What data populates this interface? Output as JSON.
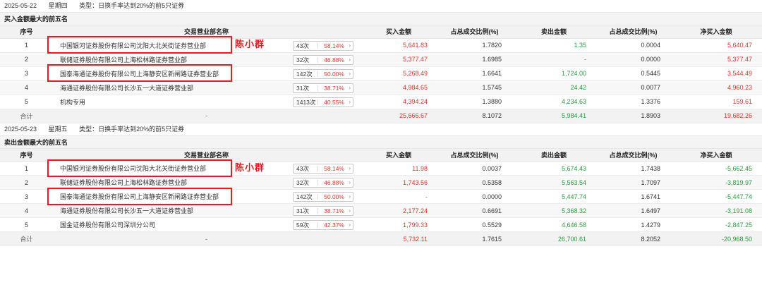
{
  "blocks": [
    {
      "date": "2025-05-22",
      "weekday": "星期四",
      "type_text": "类型：日换手率达到20%的前5只证券",
      "section_title": "买入金额最大的前五名",
      "rows": [
        {
          "idx": "1",
          "name": "中国银河证券股份有限公司沈阳大北关街证券营业部",
          "count": "43次",
          "pct": "58.14%",
          "buy": "5,641.83",
          "buy_ratio": "1.7820",
          "sell": "1.35",
          "sell_ratio": "0.0004",
          "net": "5,640.47"
        },
        {
          "idx": "2",
          "name": "联储证券股份有限公司上海松林路证券营业部",
          "count": "32次",
          "pct": "46.88%",
          "buy": "5,377.47",
          "buy_ratio": "1.6985",
          "sell": "-",
          "sell_ratio": "0.0000",
          "net": "5,377.47"
        },
        {
          "idx": "3",
          "name": "国泰海通证券股份有限公司上海静安区新闸路证券营业部",
          "count": "142次",
          "pct": "50.00%",
          "buy": "5,268.49",
          "buy_ratio": "1.6641",
          "sell": "1,724.00",
          "sell_ratio": "0.5445",
          "net": "3,544.49"
        },
        {
          "idx": "4",
          "name": "海通证券股份有限公司长沙五一大道证券营业部",
          "count": "31次",
          "pct": "38.71%",
          "buy": "4,984.65",
          "buy_ratio": "1.5745",
          "sell": "24.42",
          "sell_ratio": "0.0077",
          "net": "4,960.23"
        },
        {
          "idx": "5",
          "name": "机构专用",
          "count": "1413次",
          "pct": "40.55%",
          "buy": "4,394.24",
          "buy_ratio": "1.3880",
          "sell": "4,234.63",
          "sell_ratio": "1.3376",
          "net": "159.61"
        }
      ],
      "total": {
        "label": "合计",
        "name": "-",
        "buy": "25,666.67",
        "buy_ratio": "8.1072",
        "sell": "5,984.41",
        "sell_ratio": "1.8903",
        "net": "19,682.26"
      }
    },
    {
      "date": "2025-05-23",
      "weekday": "星期五",
      "type_text": "类型：日换手率达到20%的前5只证券",
      "section_title": "卖出金额最大的前五名",
      "rows": [
        {
          "idx": "1",
          "name": "中国银河证券股份有限公司沈阳大北关街证券营业部",
          "count": "43次",
          "pct": "58.14%",
          "buy": "11.98",
          "buy_ratio": "0.0037",
          "sell": "5,674.43",
          "sell_ratio": "1.7438",
          "net": "-5,662.45"
        },
        {
          "idx": "2",
          "name": "联储证券股份有限公司上海松林路证券营业部",
          "count": "32次",
          "pct": "46.88%",
          "buy": "1,743.56",
          "buy_ratio": "0.5358",
          "sell": "5,563.54",
          "sell_ratio": "1.7097",
          "net": "-3,819.97"
        },
        {
          "idx": "3",
          "name": "国泰海通证券股份有限公司上海静安区新闸路证券营业部",
          "count": "142次",
          "pct": "50.00%",
          "buy": "-",
          "buy_ratio": "0.0000",
          "sell": "5,447.74",
          "sell_ratio": "1.6741",
          "net": "-5,447.74"
        },
        {
          "idx": "4",
          "name": "海通证券股份有限公司长沙五一大道证券营业部",
          "count": "31次",
          "pct": "38.71%",
          "buy": "2,177.24",
          "buy_ratio": "0.6691",
          "sell": "5,368.32",
          "sell_ratio": "1.6497",
          "net": "-3,191.08"
        },
        {
          "idx": "5",
          "name": "国金证券股份有限公司深圳分公司",
          "count": "59次",
          "pct": "42.37%",
          "buy": "1,799.33",
          "buy_ratio": "0.5529",
          "sell": "4,646.58",
          "sell_ratio": "1.4279",
          "net": "-2,847.25"
        }
      ],
      "total": {
        "label": "合计",
        "name": "-",
        "buy": "5,732.11",
        "buy_ratio": "1.7615",
        "sell": "26,700.61",
        "sell_ratio": "8.2052",
        "net": "-20,968.50"
      }
    }
  ],
  "headers": {
    "idx": "序号",
    "name": "交易营业部名称",
    "buy": "买入金额",
    "buy_ratio": "占总成交比例(%)",
    "sell": "卖出金额",
    "sell_ratio": "占总成交比例(%)",
    "net": "净买入金额"
  },
  "annotations": {
    "handwritten_name": "陈小群",
    "highlight_color": "#e31b23"
  },
  "colors": {
    "up": "#e0352b",
    "down": "#2a9a3e"
  },
  "icons": {
    "badge_arrow": "chevron-right-icon"
  }
}
